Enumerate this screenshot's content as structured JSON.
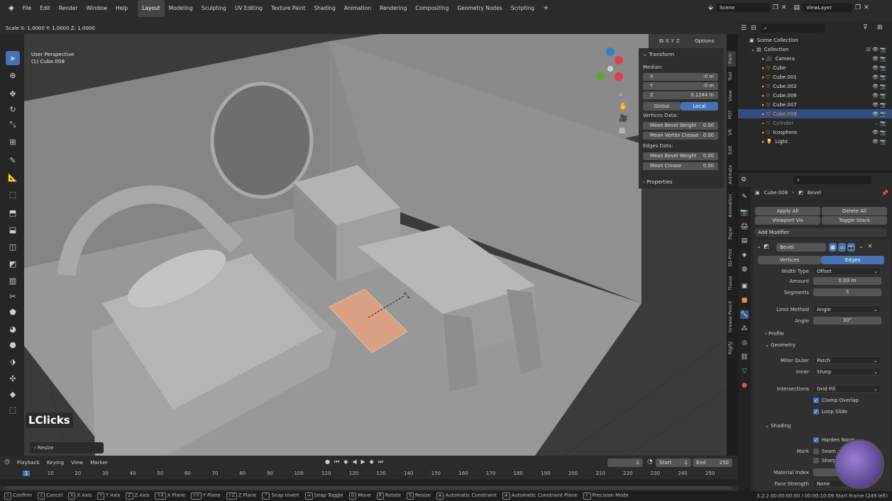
{
  "menu": {
    "items": [
      "File",
      "Edit",
      "Render",
      "Window",
      "Help"
    ]
  },
  "workspaces": [
    "Layout",
    "Modeling",
    "Sculpting",
    "UV Editing",
    "Texture Paint",
    "Shading",
    "Animation",
    "Rendering",
    "Compositing",
    "Geometry Nodes",
    "Scripting"
  ],
  "active_workspace": "Layout",
  "scene": {
    "name": "Scene",
    "view_layer": "ViewLayer"
  },
  "transform_header": {
    "scale": "Scale X: 1.0000   Y: 1.0000  Z: 1.0000"
  },
  "viewport": {
    "perspective": "User Perspective",
    "object": "(1) Cube.008",
    "options": "Options",
    "watermark": "LClicks",
    "last_op": "Resize"
  },
  "npanel": {
    "title": "Transform",
    "median": "Median:",
    "x_label": "X",
    "x_value": "-0 m",
    "y_label": "Y",
    "y_value": "-0 m",
    "z_label": "Z",
    "z_value": "0.1244 m",
    "global": "Global",
    "local": "Local",
    "vertices_data": "Vertices Data:",
    "mean_bevel_weight": "Mean Bevel Weight",
    "mbw_value": "0.00",
    "mean_vertex_crease": "Mean Vertex Crease",
    "mvc_value": "0.00",
    "edges_data": "Edges Data:",
    "edge_bevel_weight": "Mean Bevel Weight",
    "ebw_value": "0.00",
    "mean_crease": "Mean Crease",
    "mc_value": "0.00",
    "properties": "Properties"
  },
  "side_tabs": [
    "Item",
    "Tool",
    "View",
    "PDT",
    "VR",
    "Edit",
    "Animate",
    "Animation",
    "Paper",
    "3D-Print",
    "Tissue",
    "Grease Pencil",
    "Rigify"
  ],
  "outliner": {
    "scene_collection": "Scene Collection",
    "collection": "Collection",
    "items": [
      "Camera",
      "Cube",
      "Cube.001",
      "Cube.002",
      "Cube.006",
      "Cube.007",
      "Cube.008",
      "Cylinder",
      "Icosphere",
      "Light"
    ],
    "selected": "Cube.008"
  },
  "properties": {
    "object": "Cube.008",
    "modifier_breadcrumb": "Bevel",
    "apply_all": "Apply All",
    "delete_all": "Delete All",
    "viewport_vis": "Viewport Vis",
    "toggle_stack": "Toggle Stack",
    "add_modifier": "Add Modifier",
    "modifier_name": "Bevel",
    "vertices": "Vertices",
    "edges": "Edges",
    "width_type_label": "Width Type",
    "width_type": "Offset",
    "amount_label": "Amount",
    "amount": "0.03 m",
    "segments_label": "Segments",
    "segments": "3",
    "limit_method_label": "Limit Method",
    "limit_method": "Angle",
    "angle_label": "Angle",
    "angle": "30°",
    "profile": "Profile",
    "geometry": "Geometry",
    "miter_outer_label": "Miter Outer",
    "miter_outer": "Patch",
    "inner_label": "Inner",
    "inner": "Sharp",
    "intersections_label": "Intersections",
    "intersections": "Grid Fill",
    "clamp_overlap": "Clamp Overlap",
    "loop_slide": "Loop Slide",
    "shading": "Shading",
    "harden_normals": "Harden Norm",
    "mark_label": "Mark",
    "seam": "Seam",
    "sharp": "Sharp",
    "material_index_label": "Material Index",
    "face_strength_label": "Face Strength",
    "face_strength": "None"
  },
  "timeline": {
    "playback": "Playback",
    "keying": "Keying",
    "view": "View",
    "marker": "Marker",
    "current_frame": "1",
    "start_label": "Start",
    "start": "1",
    "end_label": "End",
    "end": "250",
    "ticks": [
      "1",
      "10",
      "20",
      "30",
      "40",
      "50",
      "60",
      "70",
      "80",
      "90",
      "100",
      "110",
      "120",
      "130",
      "140",
      "150",
      "160",
      "170",
      "180",
      "190",
      "200",
      "210",
      "220",
      "230",
      "240",
      "250"
    ]
  },
  "status": {
    "confirm": "Confirm",
    "cancel": "Cancel",
    "x_axis": "X Axis",
    "y_axis": "Y Axis",
    "z_axis": "Z Axis",
    "x_plane": "X Plane",
    "y_plane": "Y Plane",
    "z_plane": "Z Plane",
    "snap_invert": "Snap Invert",
    "snap_toggle": "Snap Toggle",
    "move": "Move",
    "rotate": "Rotate",
    "resize": "Resize",
    "auto_constraint": "Automatic Constraint",
    "auto_constraint_plane": "Automatic Constraint Plane",
    "precision": "Precision Mode",
    "version": "3.2.2",
    "time": "00:00:00:00 / 00:00:10:09",
    "start_frame": "Start Frame (249 left)"
  },
  "colors": {
    "accent": "#4772b3",
    "selected_face": "#d9a184",
    "bg": "#2b2b2b",
    "viewport_bg": "#3d3d3d"
  }
}
